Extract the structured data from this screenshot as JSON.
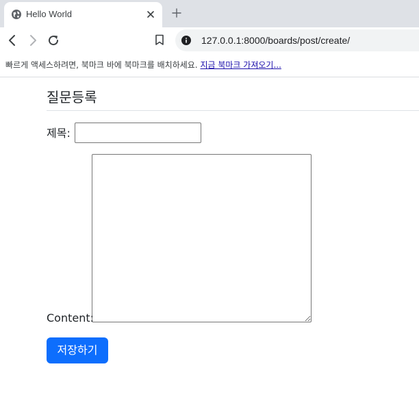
{
  "browser": {
    "tab": {
      "title": "Hello World"
    },
    "url": "127.0.0.1:8000/boards/post/create/",
    "bookmarks_bar": {
      "prompt": "빠르게 액세스하려면, 북마크 바에 북마크를 배치하세요.",
      "import_link": "지금 북마크 가져오기..."
    }
  },
  "page": {
    "title": "질문등록",
    "form": {
      "subject_label": "제목:",
      "subject_value": "",
      "content_label": "Content:",
      "content_value": "",
      "submit_label": "저장하기"
    }
  },
  "colors": {
    "tab_strip": "#dee1e6",
    "primary_button": "#0d6efd",
    "link": "#1a0dab"
  },
  "icons": [
    "globe-icon",
    "close-icon",
    "plus-icon",
    "back-arrow-icon",
    "forward-arrow-icon",
    "reload-icon",
    "bookmark-icon",
    "info-icon"
  ]
}
